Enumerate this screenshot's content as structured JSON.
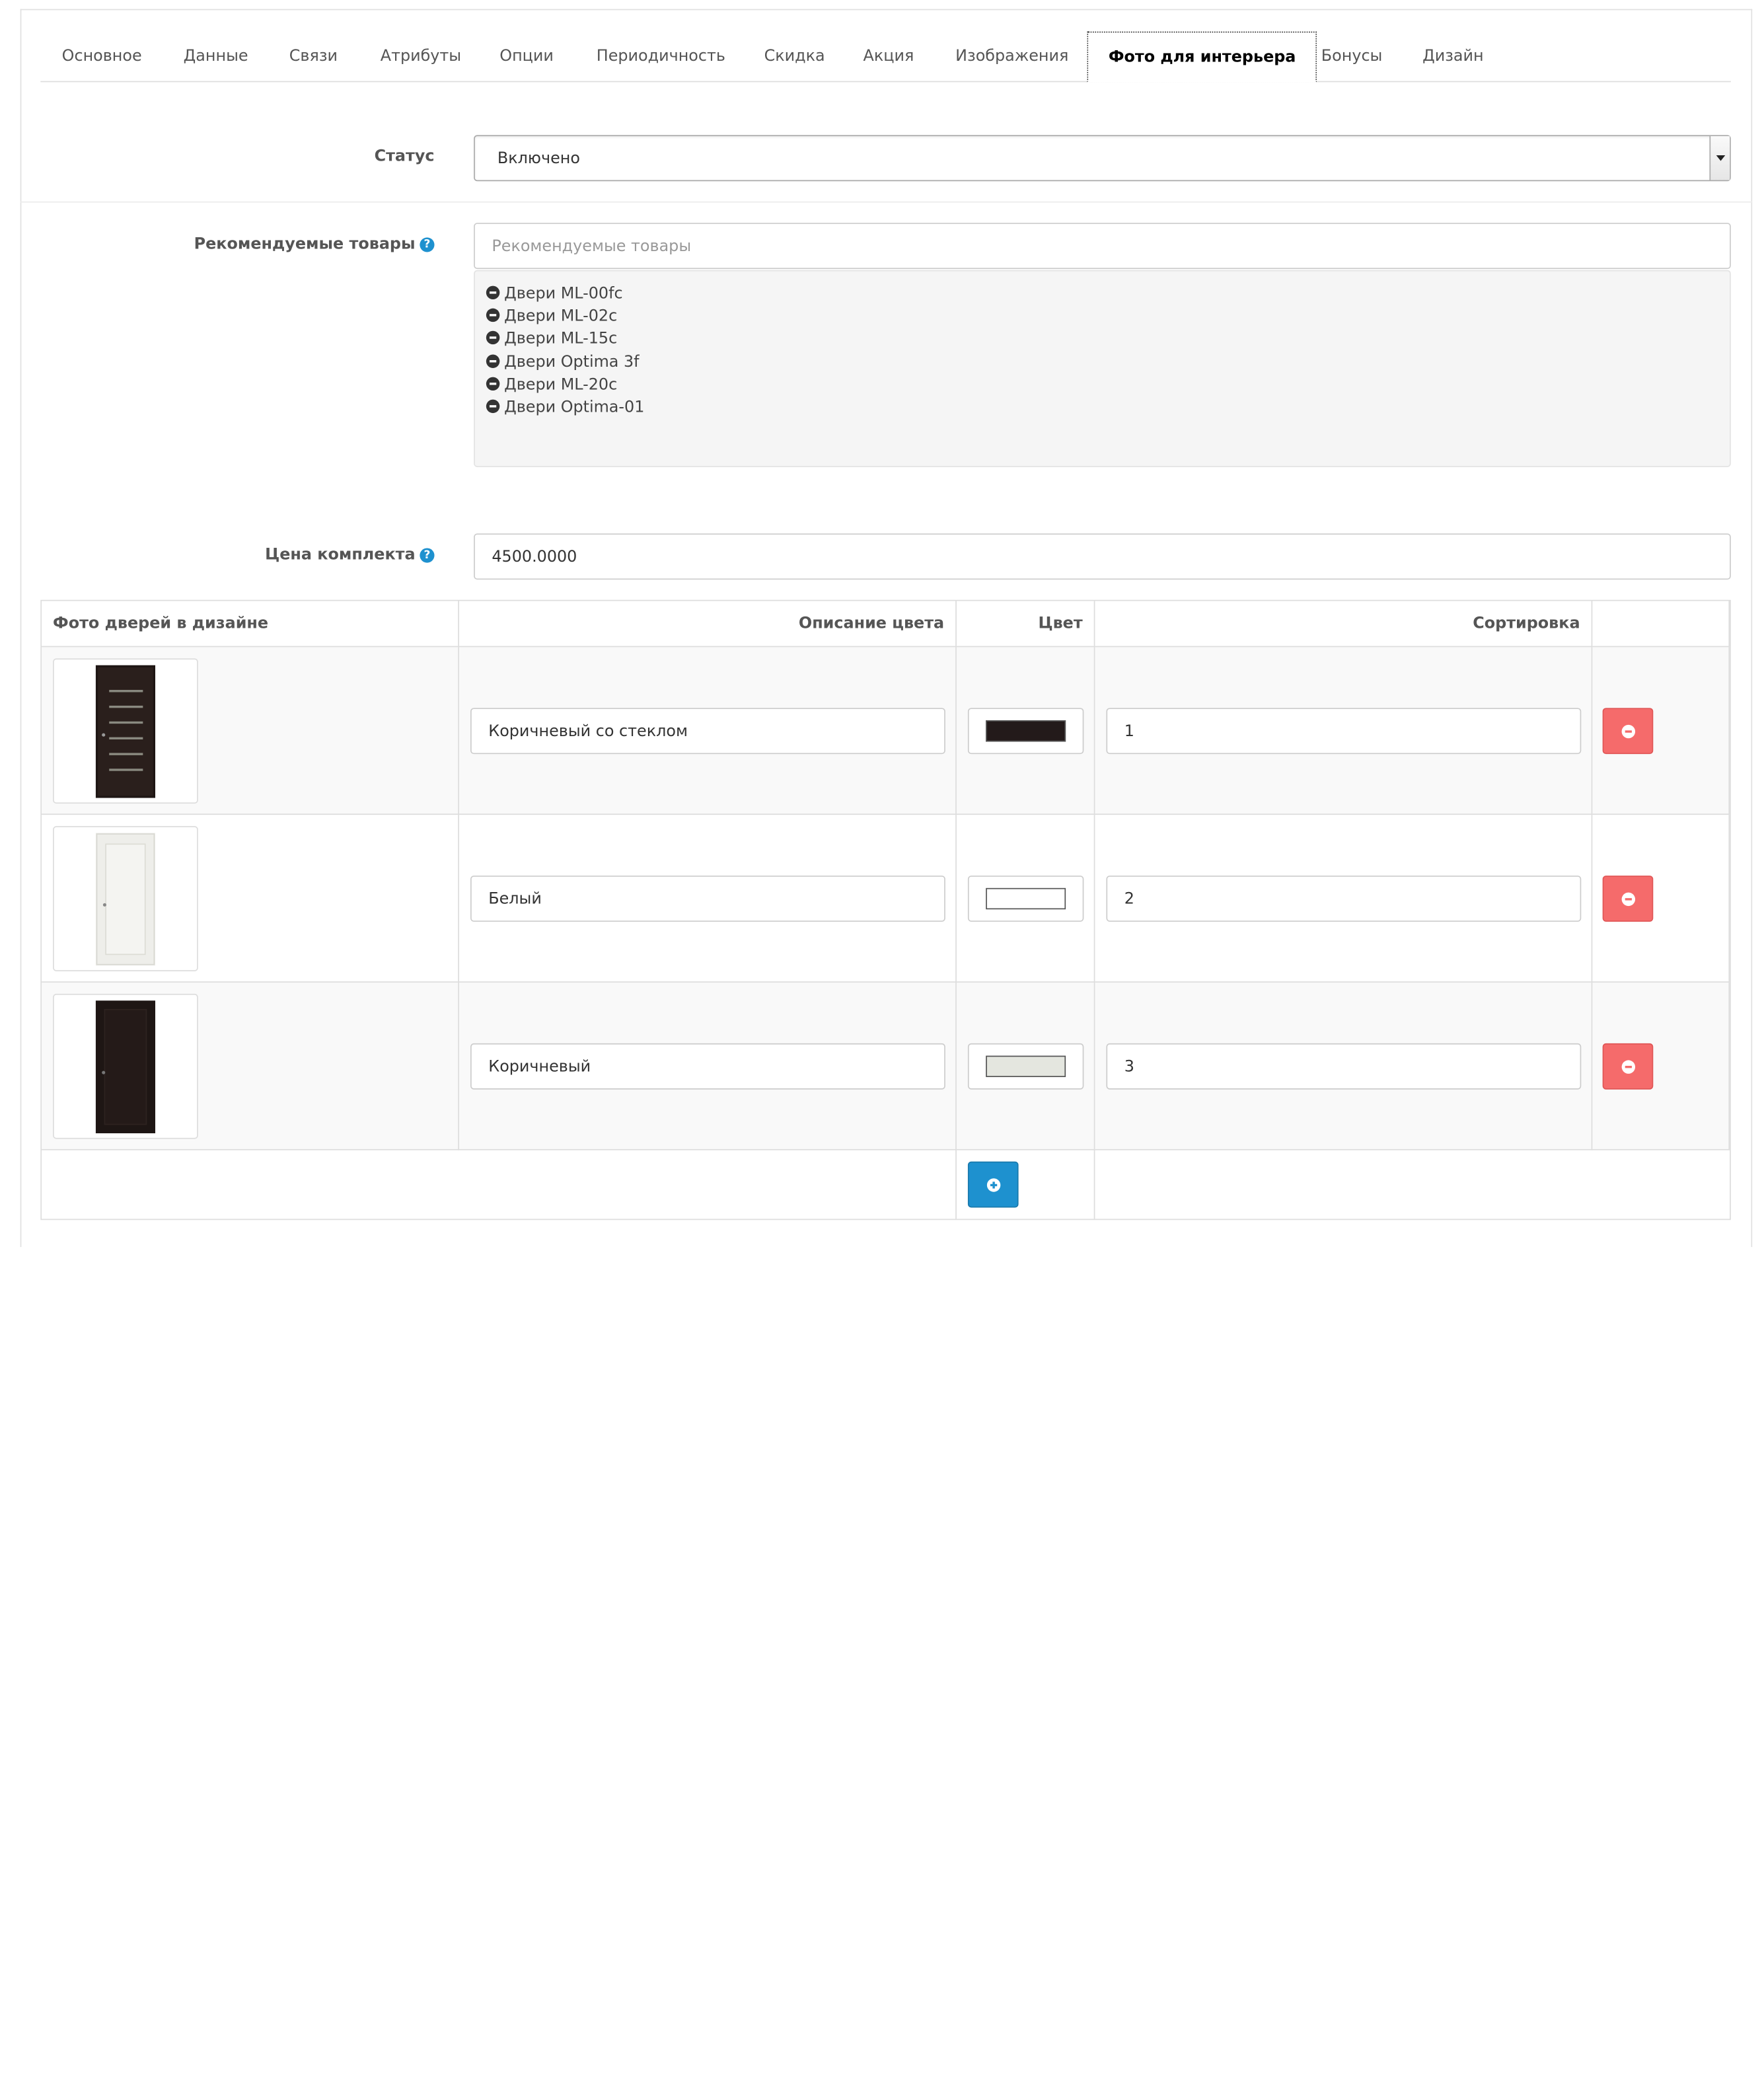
{
  "tabs": [
    {
      "label": "Основное"
    },
    {
      "label": "Данные"
    },
    {
      "label": "Связи"
    },
    {
      "label": "Атрибуты"
    },
    {
      "label": "Опции"
    },
    {
      "label": "Периодичность"
    },
    {
      "label": "Скидка"
    },
    {
      "label": "Акция"
    },
    {
      "label": "Изображения"
    },
    {
      "label": "Фото для интерьера",
      "active": true
    },
    {
      "label": "Бонусы"
    },
    {
      "label": "Дизайн"
    }
  ],
  "status": {
    "label": "Статус",
    "value": "Включено"
  },
  "recommended": {
    "label": "Рекомендуемые товары",
    "placeholder": "Рекомендуемые товары",
    "help_icon": "question-circle",
    "items": [
      "Двери ML-00fc",
      "Двери ML-02c",
      "Двери ML-15c",
      "Двери Optima 3f",
      "Двери ML-20c",
      "Двери Optima-01"
    ]
  },
  "price": {
    "label": "Цена комплекта",
    "value": "4500.0000",
    "help_icon": "question-circle"
  },
  "table": {
    "headers": {
      "photo": "Фото дверей в дизайне",
      "description": "Описание цвета",
      "color": "Цвет",
      "sort": "Сортировка"
    },
    "rows": [
      {
        "description": "Коричневый со стеклом",
        "color": "#231a1a",
        "sort": "1",
        "door": "dark-glass"
      },
      {
        "description": "Белый",
        "color": "#ffffff",
        "sort": "2",
        "door": "white"
      },
      {
        "description": "Коричневый",
        "color": "#e4e6df",
        "sort": "3",
        "door": "dark"
      }
    ]
  },
  "colors": {
    "primary": "#1e91cf",
    "danger": "#f56b6b",
    "well": "#f5f5f5"
  }
}
